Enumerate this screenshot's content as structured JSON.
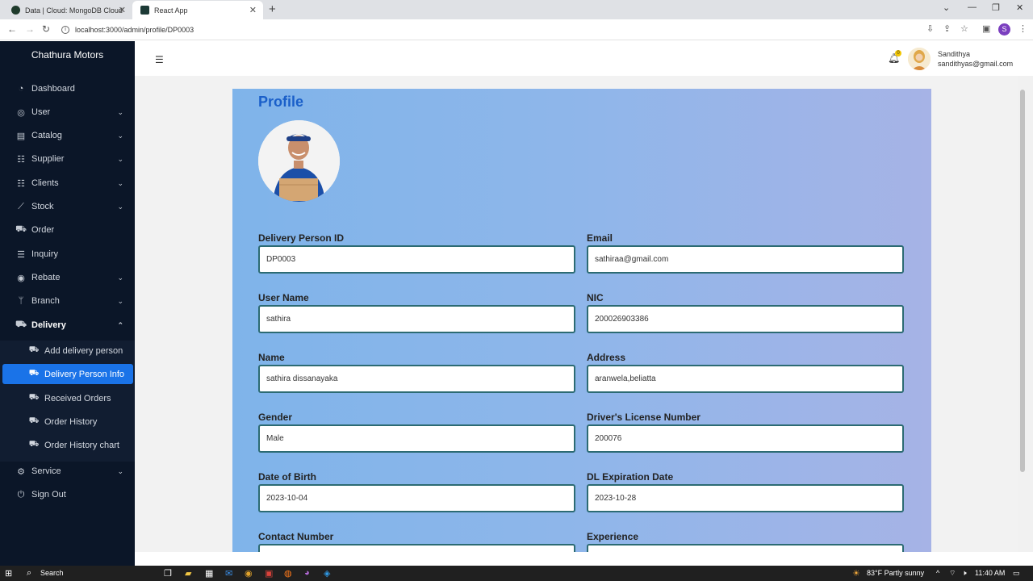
{
  "browser": {
    "tabs": [
      {
        "label": "Data | Cloud: MongoDB Cloud",
        "icon": "mongodb-leaf-icon"
      },
      {
        "label": "React App",
        "icon": "react-icon"
      }
    ],
    "url": "localhost:3000/admin/profile/DP0003",
    "profile_initial": "S"
  },
  "sidebar": {
    "brand": "Chathura Motors",
    "items": [
      {
        "label": "Dashboard",
        "icon": "dashboard-icon",
        "chevron": false
      },
      {
        "label": "User",
        "icon": "user-circle-icon",
        "chevron": true
      },
      {
        "label": "Catalog",
        "icon": "catalog-icon",
        "chevron": true
      },
      {
        "label": "Supplier",
        "icon": "supplier-icon",
        "chevron": true
      },
      {
        "label": "Clients",
        "icon": "clients-icon",
        "chevron": true
      },
      {
        "label": "Stock",
        "icon": "stock-chart-icon",
        "chevron": true
      },
      {
        "label": "Order",
        "icon": "cart-icon",
        "chevron": false
      },
      {
        "label": "Inquiry",
        "icon": "inquiry-icon",
        "chevron": false
      },
      {
        "label": "Rebate",
        "icon": "rebate-icon",
        "chevron": true
      },
      {
        "label": "Branch",
        "icon": "branch-icon",
        "chevron": true
      },
      {
        "label": "Delivery",
        "icon": "truck-icon",
        "chevron": true
      }
    ],
    "delivery_sub": [
      {
        "label": "Add delivery person"
      },
      {
        "label": "Delivery Person Info"
      },
      {
        "label": "Received Orders"
      },
      {
        "label": "Order History"
      },
      {
        "label": "Order History chart"
      }
    ],
    "after": [
      {
        "label": "Service",
        "icon": "service-icon",
        "chevron": true
      },
      {
        "label": "Sign Out",
        "icon": "power-icon",
        "chevron": false
      }
    ]
  },
  "header": {
    "notification_count": "0",
    "user_name": "Sandithya",
    "user_email": "sandithyas@gmail.com"
  },
  "profile": {
    "title": "Profile",
    "fields": [
      {
        "label": "Delivery Person ID",
        "value": "DP0003"
      },
      {
        "label": "Email",
        "value": "sathiraa@gmail.com"
      },
      {
        "label": "User Name",
        "value": "sathira"
      },
      {
        "label": "NIC",
        "value": "200026903386"
      },
      {
        "label": "Name",
        "value": "sathira dissanayaka"
      },
      {
        "label": "Address",
        "value": "aranwela,beliatta"
      },
      {
        "label": "Gender",
        "value": "Male"
      },
      {
        "label": "Driver's License Number",
        "value": "200076"
      },
      {
        "label": "Date of Birth",
        "value": "2023-10-04"
      },
      {
        "label": "DL Expiration Date",
        "value": "2023-10-28"
      },
      {
        "label": "Contact Number",
        "value": ""
      },
      {
        "label": "Experience",
        "value": ""
      }
    ]
  },
  "taskbar": {
    "search_label": "Search",
    "weather": "83°F  Partly sunny",
    "time": "11:40 AM"
  }
}
